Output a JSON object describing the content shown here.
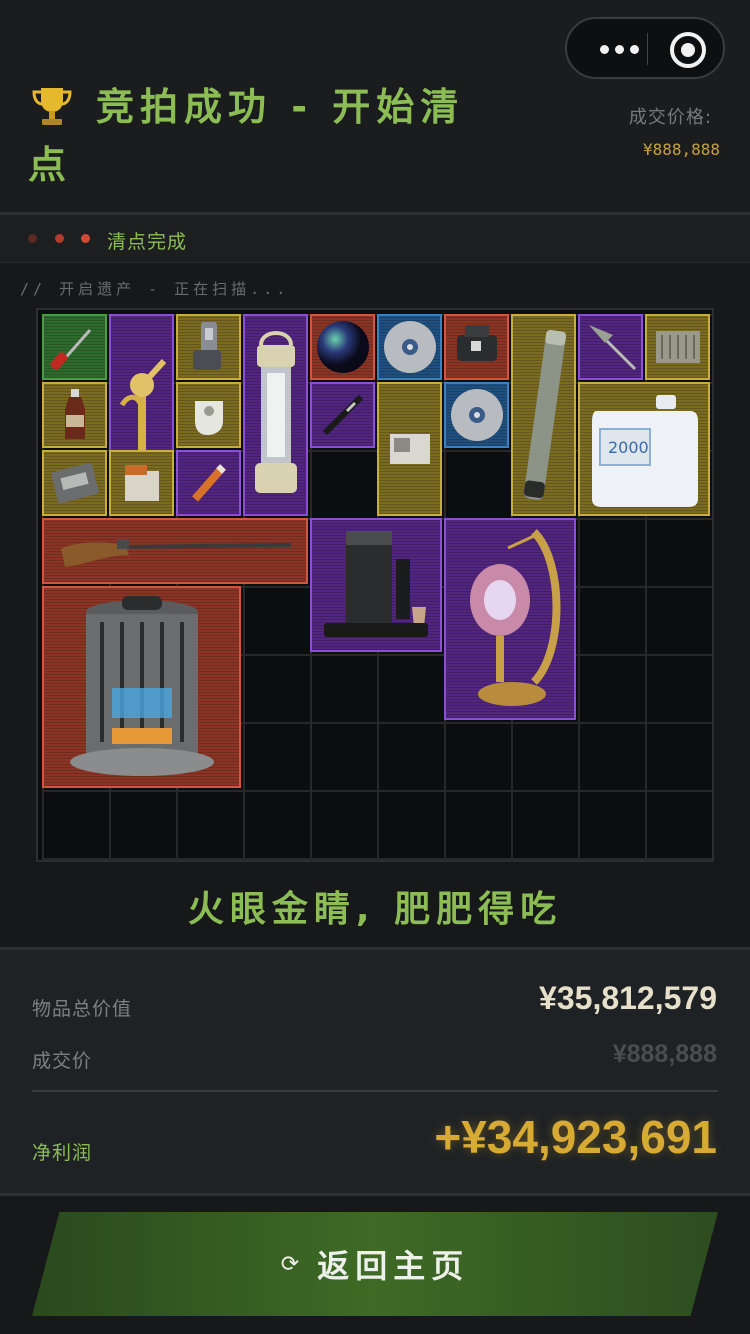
{
  "header": {
    "title": "竞拍成功 - 开始清点",
    "deal_price_label": "成交价格:",
    "deal_price_value": "¥888,888",
    "trophy_icon": "trophy-icon",
    "menu_icon": "more-dots-icon",
    "close_icon": "target-circle-icon"
  },
  "status": {
    "text": "清点完成",
    "dot_colors": [
      "#5a2a24",
      "#b23d2f",
      "#d24a36"
    ]
  },
  "scan": {
    "text": "// 开启遗产 - 正在扫描..."
  },
  "rarity_colors": {
    "green": "#2f6a2d",
    "purple": "#52257f",
    "gold": "#7a6a22",
    "red": "#8a3426",
    "blue": "#1f4f7f"
  },
  "items": [
    {
      "name": "screwdriver",
      "rarity": "green"
    },
    {
      "name": "golden-faucet",
      "rarity": "purple"
    },
    {
      "name": "inhaler",
      "rarity": "gold"
    },
    {
      "name": "storm-lantern",
      "rarity": "purple"
    },
    {
      "name": "marble-orb",
      "rarity": "red"
    },
    {
      "name": "data-disc",
      "rarity": "blue"
    },
    {
      "name": "wrist-device",
      "rarity": "red"
    },
    {
      "name": "blueprint-tube",
      "rarity": "gold"
    },
    {
      "name": "spear-head",
      "rarity": "purple"
    },
    {
      "name": "circuit-box",
      "rarity": "gold"
    },
    {
      "name": "sauce-bottle",
      "rarity": "gold"
    },
    {
      "name": "white-glove",
      "rarity": "gold"
    },
    {
      "name": "fountain-pen",
      "rarity": "purple"
    },
    {
      "name": "photo-card",
      "rarity": "gold"
    },
    {
      "name": "data-disc-2",
      "rarity": "blue"
    },
    {
      "name": "water-jug",
      "rarity": "gold"
    },
    {
      "name": "ration-pack",
      "rarity": "gold"
    },
    {
      "name": "cigarette-box",
      "rarity": "gold"
    },
    {
      "name": "firecracker",
      "rarity": "purple"
    },
    {
      "name": "flintlock-rifle",
      "rarity": "red"
    },
    {
      "name": "coffee-machine",
      "rarity": "purple"
    },
    {
      "name": "moon-lamp",
      "rarity": "purple"
    },
    {
      "name": "reactor-core",
      "rarity": "red"
    }
  ],
  "jug_label": "2000",
  "slogan": "火眼金睛, 肥肥得吃",
  "summary": {
    "total_label": "物品总价值",
    "total_value": "¥35,812,579",
    "deal_label": "成交价",
    "deal_value": "¥888,888",
    "profit_label": "净利润",
    "profit_value": "+¥34,923,691"
  },
  "home_button": {
    "label": "返回主页",
    "icon_glyph": "⟳"
  }
}
